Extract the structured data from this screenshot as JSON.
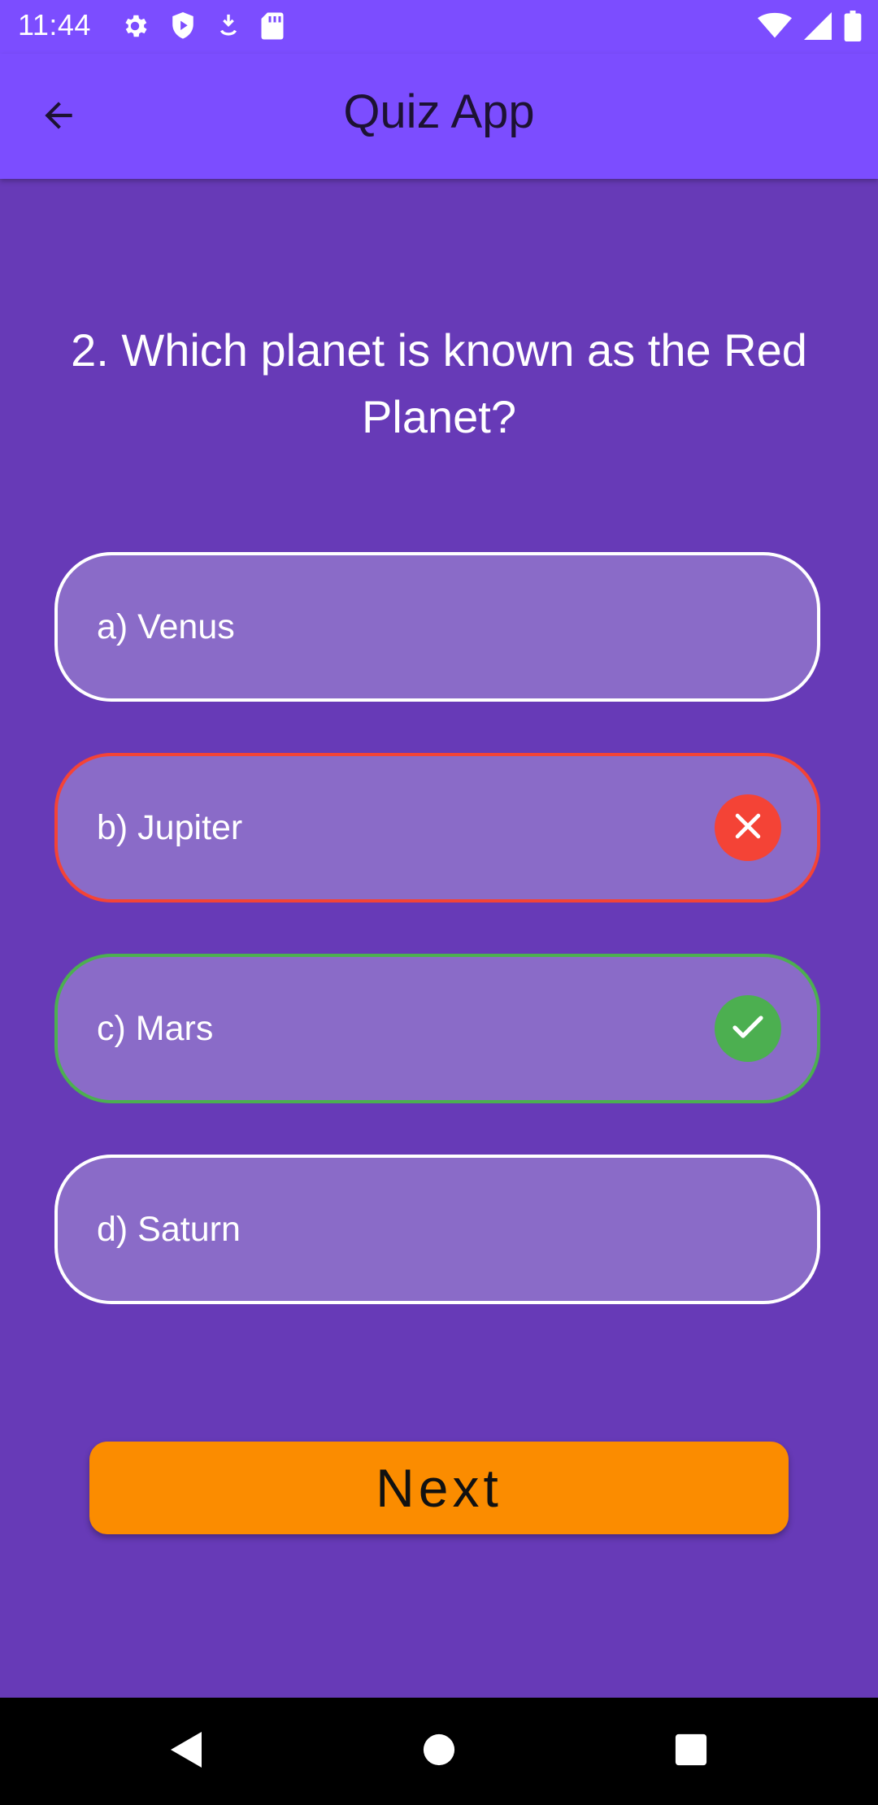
{
  "status_bar": {
    "time": "11:44",
    "left_icons": [
      "gear-icon",
      "shield-icon",
      "download-icon",
      "sd-card-icon"
    ],
    "right_icons": [
      "wifi-icon",
      "signal-icon",
      "battery-icon"
    ]
  },
  "app_bar": {
    "title": "Quiz App",
    "back_icon": "arrow-left-icon"
  },
  "quiz": {
    "question": "2. Which planet is known as the Red Planet?",
    "options": [
      {
        "label": "a) Venus",
        "state": "neutral"
      },
      {
        "label": "b) Jupiter",
        "state": "wrong",
        "icon": "close-icon"
      },
      {
        "label": "c) Mars",
        "state": "correct",
        "icon": "check-icon"
      },
      {
        "label": "d) Saturn",
        "state": "neutral"
      }
    ],
    "next_label": "Next"
  },
  "colors": {
    "app_bar": "#7C4DFF",
    "background": "#673AB7",
    "option_fill": "#8A6BC8",
    "wrong": "#F44336",
    "correct": "#4CAF50",
    "next_button": "#FB8C00"
  },
  "nav_bar": {
    "icons": [
      "back-triangle-icon",
      "home-circle-icon",
      "recents-square-icon"
    ]
  }
}
